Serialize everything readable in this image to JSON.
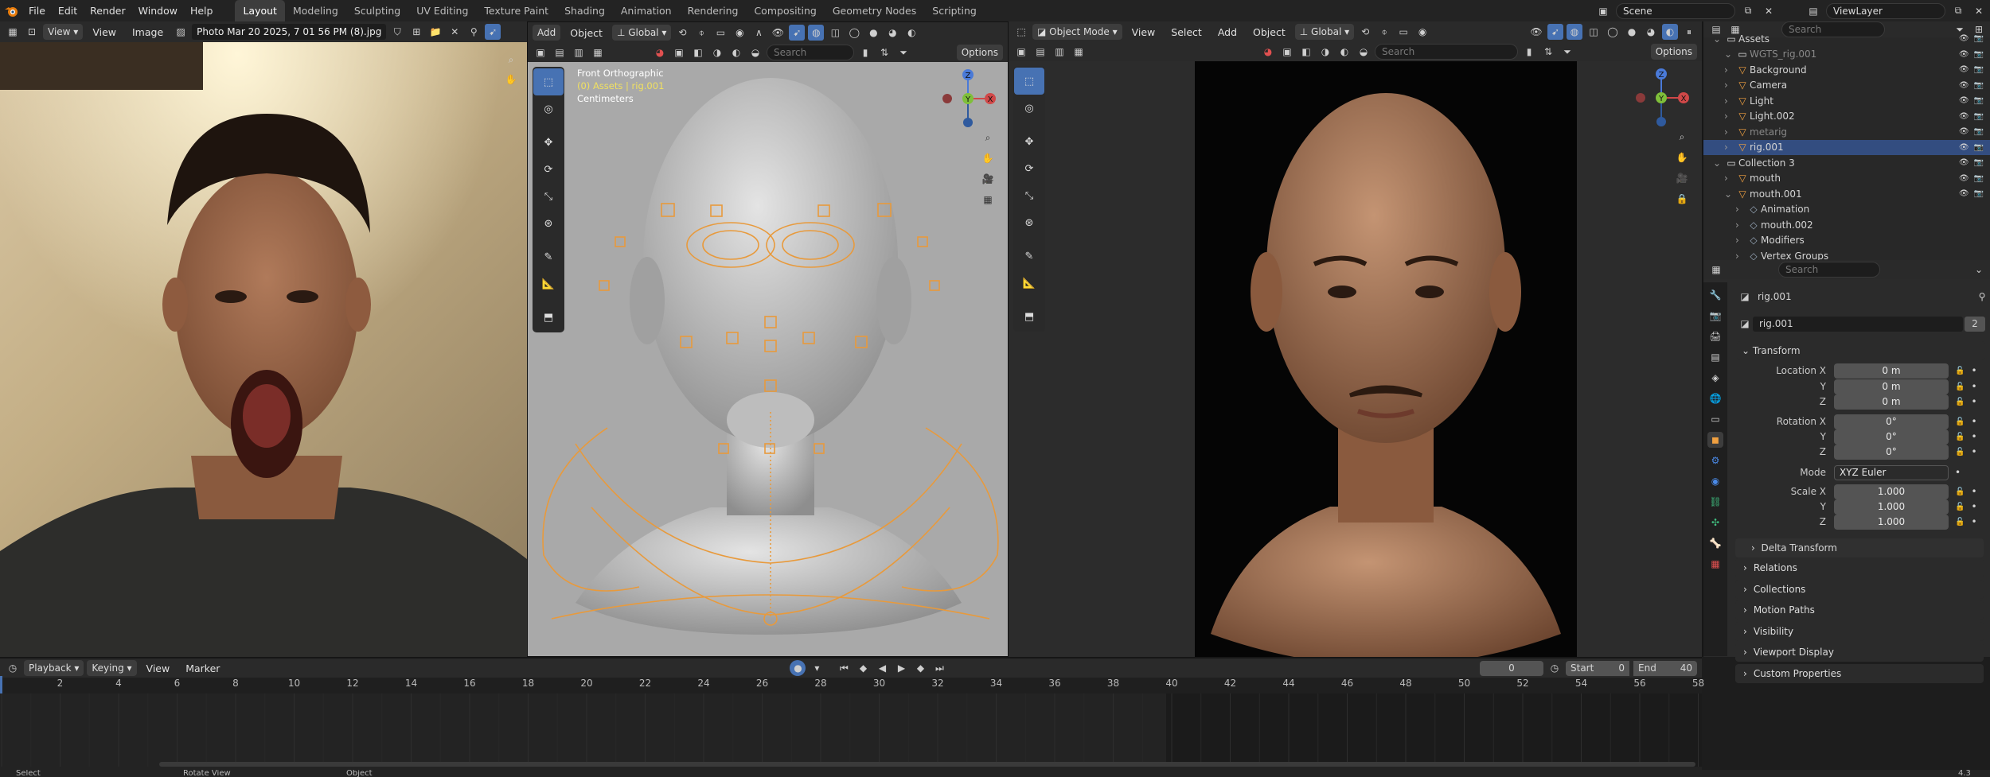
{
  "top_menu": [
    "File",
    "Edit",
    "Render",
    "Window",
    "Help"
  ],
  "workspaces": [
    "Layout",
    "Modeling",
    "Sculpting",
    "UV Editing",
    "Texture Paint",
    "Shading",
    "Animation",
    "Rendering",
    "Compositing",
    "Geometry Nodes",
    "Scripting"
  ],
  "active_workspace": "Layout",
  "scene_name": "Scene",
  "view_layer": "ViewLayer",
  "image_editor": {
    "menus": [
      "View",
      "View",
      "Image"
    ],
    "image_name": "Photo Mar 20 2025, 7 01 56 PM (8).jpg"
  },
  "viewport_left": {
    "menus": [
      "Add",
      "Object"
    ],
    "orientation": "Global",
    "search_placeholder": "Search",
    "options_label": "Options",
    "overlay_title": "Front Orthographic",
    "overlay_object": "(0) Assets | rig.001",
    "overlay_units": "Centimeters"
  },
  "viewport_right": {
    "mode": "Object Mode",
    "menus": [
      "View",
      "Select",
      "Add",
      "Object"
    ],
    "orientation": "Global",
    "search_placeholder": "Search",
    "options_label": "Options"
  },
  "gizmo_axes": {
    "x": "X",
    "y": "Y",
    "z": "Z"
  },
  "outliner": {
    "search_placeholder": "Search",
    "rows": [
      {
        "label": "Assets",
        "indent": 0,
        "type": "collection"
      },
      {
        "label": "WGTS_rig.001",
        "indent": 1,
        "type": "collection",
        "dim": true
      },
      {
        "label": "Background",
        "indent": 1,
        "type": "object"
      },
      {
        "label": "Camera",
        "indent": 1,
        "type": "object"
      },
      {
        "label": "Light",
        "indent": 1,
        "type": "object"
      },
      {
        "label": "Light.002",
        "indent": 1,
        "type": "object"
      },
      {
        "label": "metarig",
        "indent": 1,
        "type": "object",
        "dim": true
      },
      {
        "label": "rig.001",
        "indent": 1,
        "type": "object",
        "selected": true
      },
      {
        "label": "Collection 3",
        "indent": 0,
        "type": "collection"
      },
      {
        "label": "mouth",
        "indent": 1,
        "type": "object"
      },
      {
        "label": "mouth.001",
        "indent": 1,
        "type": "object"
      },
      {
        "label": "Animation",
        "indent": 2,
        "type": "sub"
      },
      {
        "label": "mouth.002",
        "indent": 2,
        "type": "sub"
      },
      {
        "label": "Modifiers",
        "indent": 2,
        "type": "sub"
      },
      {
        "label": "Vertex Groups",
        "indent": 2,
        "type": "sub"
      }
    ]
  },
  "properties": {
    "search_placeholder": "Search",
    "object_name": "rig.001",
    "datablock_name": "rig.001",
    "users": "2",
    "transform_title": "Transform",
    "location": {
      "label": "Location X",
      "x": "0 m",
      "y": "0 m",
      "z": "0 m"
    },
    "rotation": {
      "label": "Rotation X",
      "x": "0°",
      "y": "0°",
      "z": "0°"
    },
    "mode_label": "Mode",
    "mode_value": "XYZ Euler",
    "scale": {
      "label": "Scale X",
      "x": "1.000",
      "y": "1.000",
      "z": "1.000"
    },
    "axis_labels": {
      "y": "Y",
      "z": "Z"
    },
    "delta_transform": "Delta Transform",
    "panels": [
      "Relations",
      "Collections",
      "Motion Paths",
      "Visibility",
      "Viewport Display",
      "Custom Properties"
    ]
  },
  "timeline": {
    "menus": [
      "Playback",
      "Keying",
      "View",
      "Marker"
    ],
    "current_frame": "0",
    "start_label": "Start",
    "start_value": "0",
    "end_label": "End",
    "end_value": "40",
    "ticks": [
      "2",
      "4",
      "6",
      "8",
      "10",
      "12",
      "14",
      "16",
      "18",
      "20",
      "22",
      "24",
      "26",
      "28",
      "30",
      "32",
      "34",
      "36",
      "38",
      "40",
      "42",
      "44",
      "46",
      "48",
      "50",
      "52",
      "54",
      "56",
      "58"
    ]
  },
  "statusbar": {
    "items": [
      "Select",
      "Rotate View",
      "Object"
    ],
    "version": "4.3"
  },
  "colors": {
    "accent": "#4772b3",
    "rig_orange": "#e89a3c",
    "selected_row": "#334d80"
  }
}
